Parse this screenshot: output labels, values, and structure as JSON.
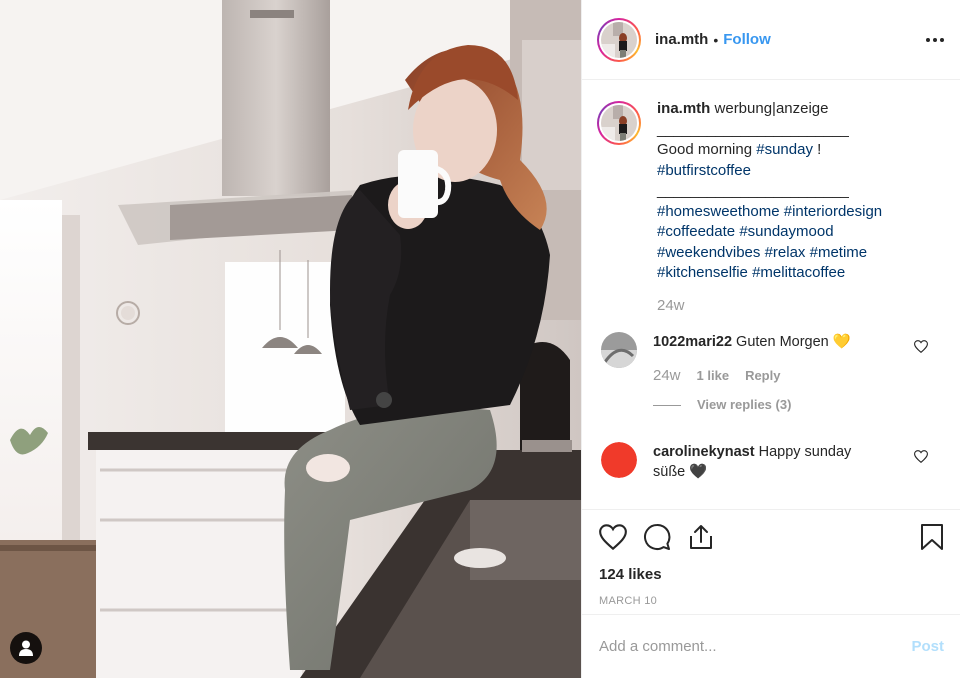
{
  "colors": {
    "link": "#3897f0",
    "hashtag": "#003569",
    "muted": "#999999",
    "post_disabled": "#b2dffc",
    "comment_avatar_red": "#f03a2a"
  },
  "post": {
    "image_alt_icon": "user-tag-icon"
  },
  "header": {
    "username": "ina.mth",
    "separator": "•",
    "follow_label": "Follow",
    "more_icon": "more-options-icon"
  },
  "caption": {
    "username": "ina.mth",
    "lines": [
      "werbung|anzeige",
      "_______________________",
      "Good morning ",
      "#sunday",
      " !",
      "#butfirstcoffee",
      "_______________________",
      "#homesweethome",
      "#interiordesign",
      "#coffeedate",
      "#sundaymood",
      "#weekendvibes",
      "#relax",
      "#metime",
      "#kitchenselfie",
      "#melittacoffee"
    ],
    "time": "24w"
  },
  "comments": [
    {
      "username": "1022mari22",
      "text": "Guten Morgen",
      "emoji": "💛",
      "age": "24w",
      "likes_label": "1 like",
      "reply_label": "Reply",
      "view_replies": "View replies (3)"
    },
    {
      "username": "carolinekynast",
      "text": "Happy sunday süße",
      "emoji": "🖤"
    }
  ],
  "actions": {
    "like_icon": "heart-icon",
    "comment_icon": "comment-icon",
    "share_icon": "share-icon",
    "save_icon": "bookmark-icon",
    "likes": "124 likes",
    "date": "MARCH 10"
  },
  "add_comment": {
    "placeholder": "Add a comment...",
    "post_label": "Post"
  }
}
